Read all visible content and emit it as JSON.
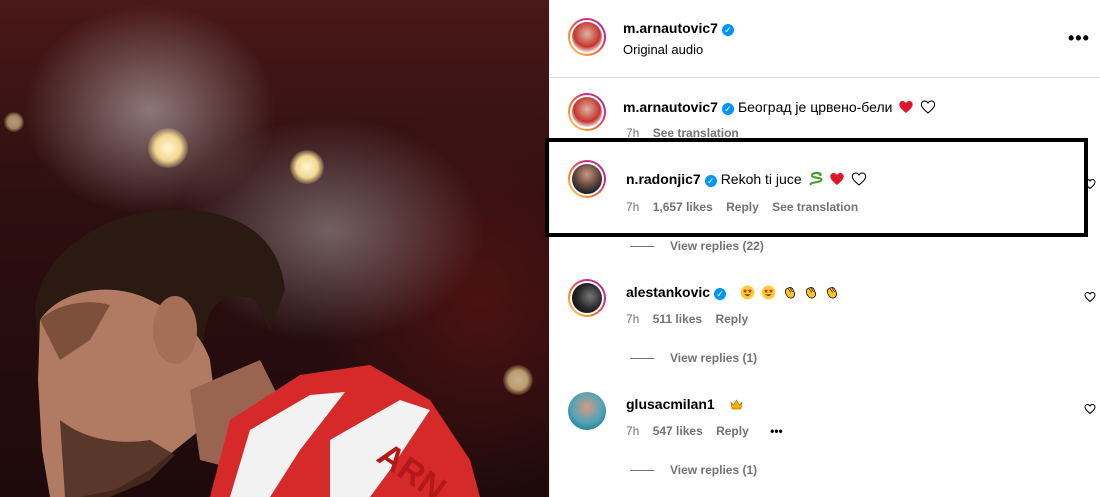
{
  "header": {
    "username": "m.arnautovic7",
    "audio": "Original audio",
    "more_label": "•••"
  },
  "caption": {
    "username": "m.arnautovic7",
    "text": "Београд је црвено-бели",
    "time": "7h",
    "translate": "See translation"
  },
  "comments": [
    {
      "username": "n.radonjic7",
      "text": "Rekoh ti juce",
      "time": "7h",
      "likes": "1,657 likes",
      "reply": "Reply",
      "translate": "See translation",
      "view_replies": "View replies (22)"
    },
    {
      "username": "alestankovic",
      "text": "",
      "time": "7h",
      "likes": "511 likes",
      "reply": "Reply",
      "view_replies": "View replies (1)"
    },
    {
      "username": "glusacmilan1",
      "text": "",
      "time": "7h",
      "likes": "547 likes",
      "reply": "Reply",
      "more_label": "•••",
      "view_replies": "View replies (1)"
    }
  ],
  "colors": {
    "verified": "#0095f6",
    "heart_red": "#e0142d",
    "meta_gray": "#737373"
  },
  "icons": [
    "verified-icon",
    "heart-icon",
    "snake-emoji",
    "star-struck-emoji",
    "clap-emoji",
    "crown-emoji",
    "more-icon"
  ]
}
